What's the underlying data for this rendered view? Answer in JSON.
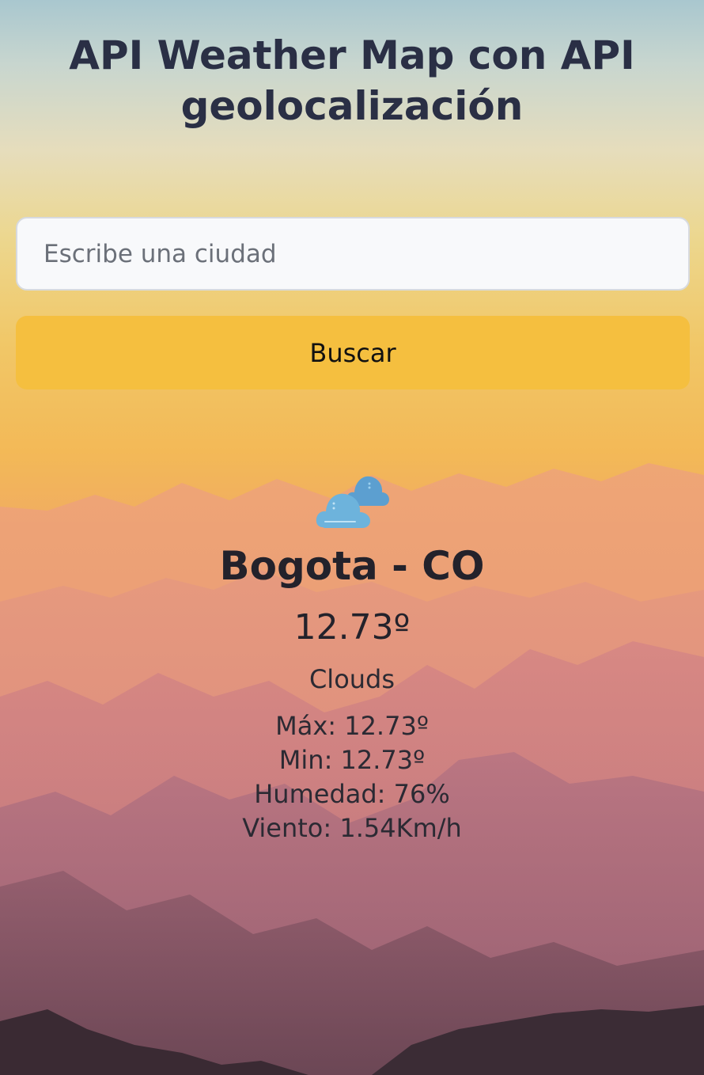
{
  "page": {
    "title": "API Weather Map con API geolocalización"
  },
  "search": {
    "value": "",
    "placeholder": "Escribe una ciudad",
    "button_label": "Buscar"
  },
  "weather": {
    "icon": "clouds-icon",
    "city": "Bogota - CO",
    "temperature": "12.73º",
    "description": "Clouds",
    "max": "Máx: 12.73º",
    "min": "Min: 12.73º",
    "humidity": "Humedad: 76%",
    "wind": "Viento: 1.54Km/h"
  },
  "colors": {
    "button": "#f5bf3f",
    "title": "#2a2f45",
    "cloud_front": "#6db3dc",
    "cloud_back": "#5c9fd0"
  }
}
